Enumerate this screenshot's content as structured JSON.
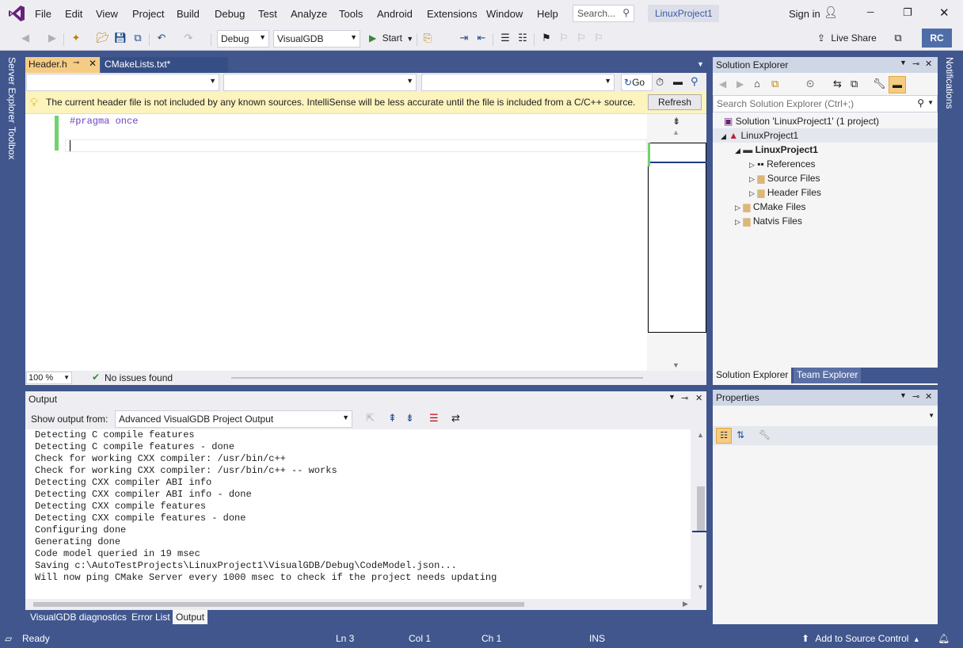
{
  "menubar": {
    "items": [
      "File",
      "Edit",
      "View",
      "Project",
      "Build",
      "Debug",
      "Test",
      "Analyze",
      "Tools",
      "Android",
      "Extensions",
      "Window",
      "Help"
    ],
    "search_placeholder": "Search...",
    "project_name": "LinuxProject1",
    "sign_in": "Sign in",
    "live_share": "Live Share",
    "avatar_initials": "RC"
  },
  "toolbar": {
    "config": "Debug",
    "platform": "VisualGDB",
    "start": "Start"
  },
  "side": {
    "server_explorer": "Server Explorer",
    "toolbox": "Toolbox",
    "notifications": "Notifications"
  },
  "editor": {
    "tabs": [
      "Header.h",
      "CMakeLists.txt*"
    ],
    "go_label": "Go",
    "info_message": "The current header file is not included by any known sources. IntelliSense will be less accurate until the file is included from a C/C++ source.",
    "refresh": "Refresh",
    "code_lines": [
      "#pragma once",
      ""
    ],
    "zoom": "100 %",
    "issues": "No issues found"
  },
  "output": {
    "title": "Output",
    "show_from_label": "Show output from:",
    "source": "Advanced VisualGDB Project Output",
    "lines": [
      "Detecting C compile features",
      "Detecting C compile features - done",
      "Check for working CXX compiler: /usr/bin/c++",
      "Check for working CXX compiler: /usr/bin/c++ -- works",
      "Detecting CXX compiler ABI info",
      "Detecting CXX compiler ABI info - done",
      "Detecting CXX compile features",
      "Detecting CXX compile features - done",
      "Configuring done",
      "Generating done",
      "Code model queried in 19 msec",
      "Saving c:\\AutoTestProjects\\LinuxProject1\\VisualGDB/Debug\\CodeModel.json...",
      "Will now ping CMake Server every 1000 msec to check if the project needs updating"
    ]
  },
  "bottom_tabs": [
    "VisualGDB diagnostics",
    "Error List",
    "Output"
  ],
  "solution_explorer": {
    "title": "Solution Explorer",
    "search_placeholder": "Search Solution Explorer (Ctrl+;)",
    "tree": [
      "Solution 'LinuxProject1' (1 project)",
      "LinuxProject1",
      "LinuxProject1",
      "References",
      "Source Files",
      "Header Files",
      "CMake Files",
      "Natvis Files"
    ],
    "tabs": [
      "Solution Explorer",
      "Team Explorer"
    ]
  },
  "properties": {
    "title": "Properties"
  },
  "statusbar": {
    "ready": "Ready",
    "ln": "Ln 3",
    "col": "Col 1",
    "ch": "Ch 1",
    "ins": "INS",
    "source_control": "Add to Source Control"
  },
  "colors": {
    "accent": "#40568d",
    "infobar": "#fcf3bd",
    "keyword": "#6f42c1"
  }
}
